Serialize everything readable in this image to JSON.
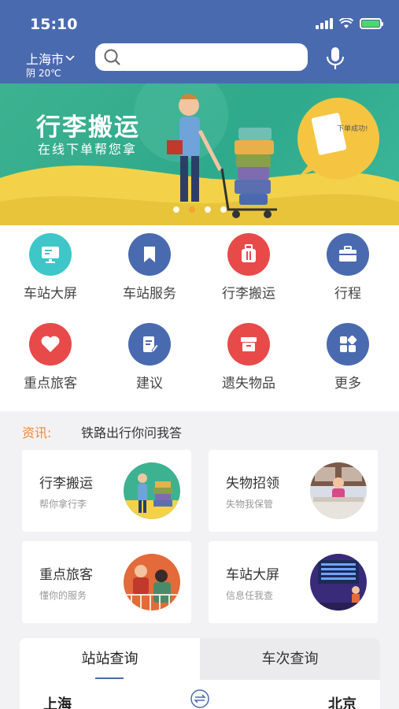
{
  "status": {
    "time": "15:10"
  },
  "header": {
    "city": "上海市",
    "weather": "阴 20℃",
    "search_placeholder": ""
  },
  "banner": {
    "title": "行李搬运",
    "subtitle": "在线下单帮您拿",
    "bubble": "下单成功!"
  },
  "grid": [
    {
      "label": "车站大屏",
      "icon": "monitor-icon",
      "color": "#3ec6c8"
    },
    {
      "label": "车站服务",
      "icon": "bookmark-icon",
      "color": "#4a6ab0"
    },
    {
      "label": "行李搬运",
      "icon": "suitcase-icon",
      "color": "#e84a4a"
    },
    {
      "label": "行程",
      "icon": "briefcase-icon",
      "color": "#4a6ab0"
    },
    {
      "label": "重点旅客",
      "icon": "heart-icon",
      "color": "#e84a4a"
    },
    {
      "label": "建议",
      "icon": "edit-document-icon",
      "color": "#4a6ab0"
    },
    {
      "label": "遗失物品",
      "icon": "box-icon",
      "color": "#e84a4a"
    },
    {
      "label": "更多",
      "icon": "apps-icon",
      "color": "#4a6ab0"
    }
  ],
  "news": {
    "tag": "资讯:",
    "text": "铁路出行你问我答"
  },
  "cards": [
    {
      "title": "行李搬运",
      "subtitle": "帮你拿行李"
    },
    {
      "title": "失物招领",
      "subtitle": "失物我保管"
    },
    {
      "title": "重点旅客",
      "subtitle": "懂你的服务"
    },
    {
      "title": "车站大屏",
      "subtitle": "信息任我查"
    }
  ],
  "query": {
    "tabs": [
      "站站查询",
      "车次查询"
    ],
    "from": "上海",
    "to": "北京"
  }
}
